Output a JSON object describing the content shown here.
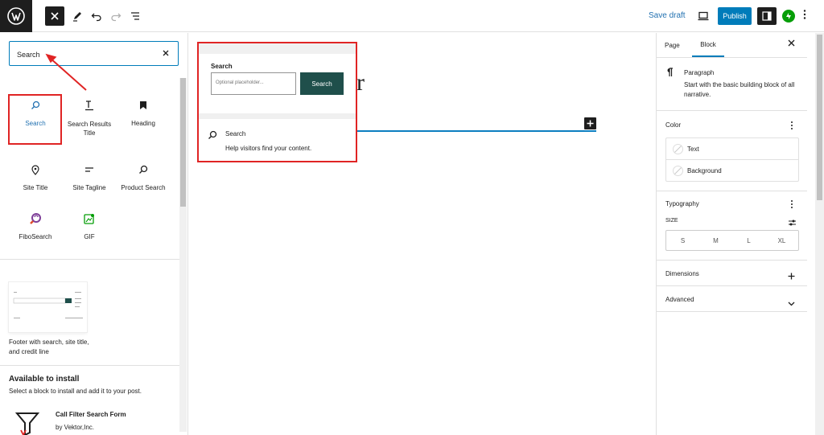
{
  "toolbar": {
    "save_draft": "Save draft",
    "publish": "Publish",
    "icons": [
      "wordpress-logo",
      "close-icon",
      "pencil-icon",
      "undo-icon",
      "redo-icon",
      "list-view-icon",
      "desktop-preview-icon",
      "settings-sidebar-icon",
      "jetpack-icon",
      "more-options-icon"
    ]
  },
  "inserter": {
    "search_value": "Search",
    "blocks": [
      {
        "label": "Search",
        "icon": "search-icon",
        "selected": true
      },
      {
        "label": "Search Results Title",
        "icon": "title-icon",
        "selected": false
      },
      {
        "label": "Heading",
        "icon": "bookmark-icon",
        "selected": false
      },
      {
        "label": "Site Title",
        "icon": "map-pin-icon",
        "selected": false
      },
      {
        "label": "Site Tagline",
        "icon": "tagline-icon",
        "selected": false
      },
      {
        "label": "Product Search",
        "icon": "search-icon",
        "selected": false
      },
      {
        "label": "FiboSearch",
        "icon": "fibosearch-icon",
        "selected": false
      },
      {
        "label": "GIF",
        "icon": "gif-icon",
        "selected": false
      }
    ],
    "pattern_label": "Footer with search, site title, and credit line",
    "available_title": "Available to install",
    "available_subtitle": "Select a block to install and add it to your post.",
    "plugin_name": "Call Filter Search Form",
    "plugin_author": "by Vektor,Inc."
  },
  "preview": {
    "label": "Search",
    "placeholder": "Optional placeholder...",
    "button": "Search",
    "info_title": "Search",
    "info_desc": "Help visitors find your content."
  },
  "canvas": {
    "title_fragment": "r"
  },
  "sidebar": {
    "tab_page": "Page",
    "tab_block": "Block",
    "block_name": "Paragraph",
    "block_desc": "Start with the basic building block of all narrative.",
    "color_title": "Color",
    "color_text": "Text",
    "color_background": "Background",
    "typography_title": "Typography",
    "size_label": "SIZE",
    "sizes": [
      "S",
      "M",
      "L",
      "XL"
    ],
    "dimensions_title": "Dimensions",
    "advanced_title": "Advanced"
  },
  "colors": {
    "accent": "#007cba",
    "highlight": "#e02424",
    "search_button": "#1f4f4b",
    "dark": "#1e1e1e"
  }
}
